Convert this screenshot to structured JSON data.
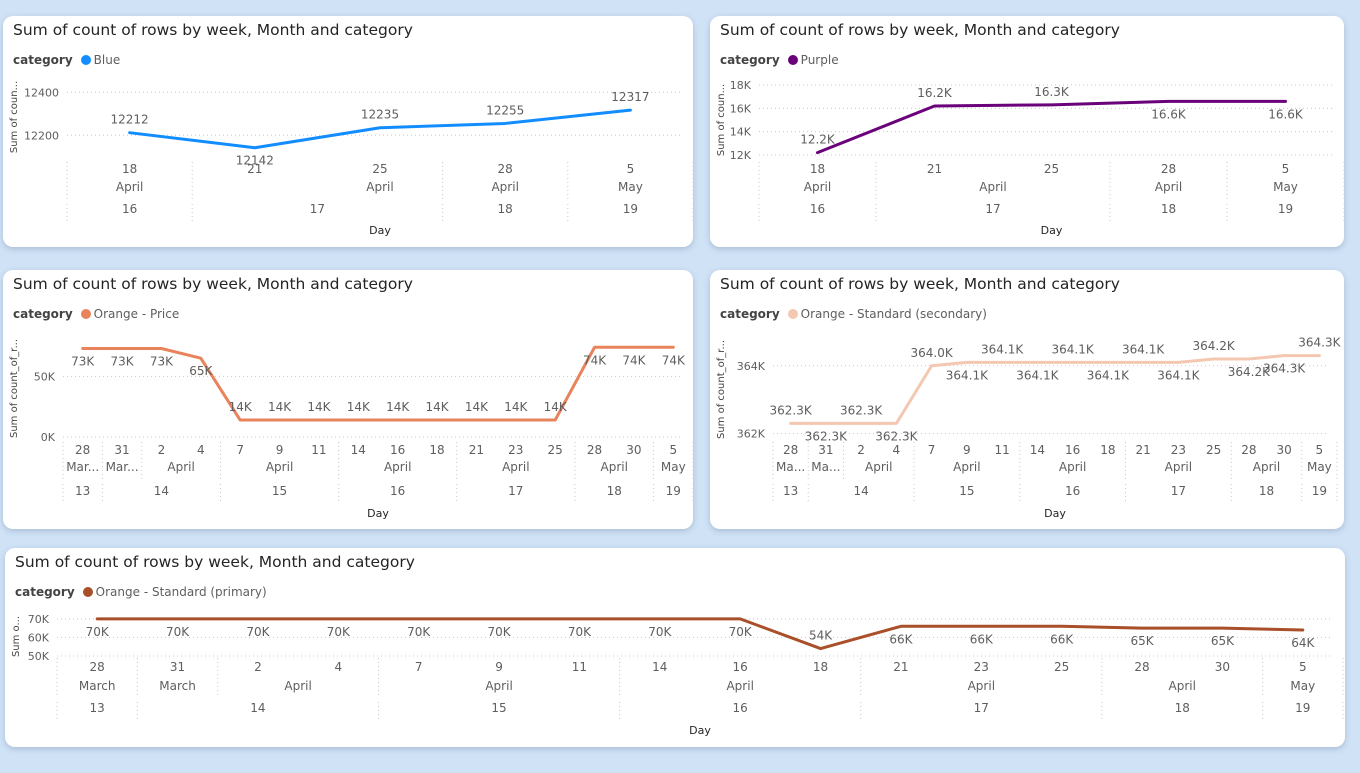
{
  "chart_data": [
    {
      "type": "line",
      "title": "Sum of count of rows by week, Month and category",
      "legend_title": "category",
      "legend_position": "top-left",
      "series": [
        {
          "name": "Blue",
          "color": "#118DFF",
          "values": [
            12212,
            12142,
            12235,
            12255,
            12317
          ]
        }
      ],
      "data_labels": [
        "12212",
        "12142",
        "12235",
        "12255",
        "12317"
      ],
      "xlabel": "Day",
      "ylabel": "Sum of coun...",
      "ylim": [
        12150,
        12420
      ],
      "yticks": [
        12200,
        12400
      ],
      "ytick_labels": [
        "12200",
        "12400"
      ],
      "days": [
        "18",
        "21",
        "25",
        "28",
        "5"
      ],
      "months": [
        {
          "label": "April",
          "start": 0,
          "end": 1
        },
        {
          "label": "April",
          "start": 1,
          "end": 4
        },
        {
          "label": "April",
          "start": 3,
          "end": 4
        },
        {
          "label": "May",
          "start": 4,
          "end": 5
        }
      ],
      "weeks": [
        {
          "label": "16",
          "start": 0,
          "end": 1
        },
        {
          "label": "17",
          "start": 1,
          "end": 3
        },
        {
          "label": "18",
          "start": 3,
          "end": 4
        },
        {
          "label": "19",
          "start": 4,
          "end": 5
        }
      ],
      "grid": true
    },
    {
      "type": "line",
      "title": "Sum of count of rows by week, Month and category",
      "legend_title": "category",
      "legend_position": "top-left",
      "series": [
        {
          "name": "Purple",
          "color": "#6B007B",
          "values": [
            12200,
            16200,
            16300,
            16600,
            16600
          ]
        }
      ],
      "data_labels": [
        "12.2K",
        "16.2K",
        "16.3K",
        "16.6K",
        "16.6K"
      ],
      "xlabel": "Day",
      "ylabel": "Sum of coun...",
      "ylim": [
        12000,
        18000
      ],
      "yticks": [
        12000,
        14000,
        16000,
        18000
      ],
      "ytick_labels": [
        "12K",
        "14K",
        "16K",
        "18K"
      ],
      "days": [
        "18",
        "21",
        "25",
        "28",
        "5"
      ],
      "months": [
        {
          "label": "April",
          "start": 0,
          "end": 1
        },
        {
          "label": "April",
          "start": 1,
          "end": 3
        },
        {
          "label": "April",
          "start": 3,
          "end": 4
        },
        {
          "label": "May",
          "start": 4,
          "end": 5
        }
      ],
      "weeks": [
        {
          "label": "16",
          "start": 0,
          "end": 1
        },
        {
          "label": "17",
          "start": 1,
          "end": 3
        },
        {
          "label": "18",
          "start": 3,
          "end": 4
        },
        {
          "label": "19",
          "start": 4,
          "end": 5
        }
      ],
      "grid": true
    },
    {
      "type": "line",
      "title": "Sum of count of rows by week, Month and category",
      "legend_title": "category",
      "legend_position": "top-left",
      "series": [
        {
          "name": "Orange - Price",
          "color": "#E8835B",
          "values": [
            73000,
            73000,
            73000,
            65000,
            14000,
            14000,
            14000,
            14000,
            14000,
            14000,
            14000,
            14000,
            14000,
            74000,
            74000,
            74000
          ]
        }
      ],
      "data_labels": [
        "73K",
        "73K",
        "73K",
        "65K",
        "14K",
        "14K",
        "14K",
        "14K",
        "14K",
        "14K",
        "14K",
        "14K",
        "14K",
        "74K",
        "74K",
        "74K"
      ],
      "xlabel": "Day",
      "ylabel": "Sum of count_of_r...",
      "ylim": [
        0,
        80000
      ],
      "yticks": [
        0,
        50000
      ],
      "ytick_labels": [
        "0K",
        "50K"
      ],
      "days": [
        "28",
        "31",
        "2",
        "4",
        "7",
        "9",
        "11",
        "14",
        "16",
        "18",
        "21",
        "23",
        "25",
        "28",
        "30",
        "5"
      ],
      "months": [
        {
          "label": "Mar...",
          "start": 0,
          "end": 1
        },
        {
          "label": "Mar...",
          "start": 1,
          "end": 2
        },
        {
          "label": "April",
          "start": 2,
          "end": 4
        },
        {
          "label": "April",
          "start": 4,
          "end": 7
        },
        {
          "label": "April",
          "start": 7,
          "end": 10
        },
        {
          "label": "April",
          "start": 10,
          "end": 13
        },
        {
          "label": "April",
          "start": 13,
          "end": 15
        },
        {
          "label": "May",
          "start": 15,
          "end": 16
        }
      ],
      "weeks": [
        {
          "label": "13",
          "start": 0,
          "end": 1
        },
        {
          "label": "14",
          "start": 1,
          "end": 4
        },
        {
          "label": "15",
          "start": 4,
          "end": 7
        },
        {
          "label": "16",
          "start": 7,
          "end": 10
        },
        {
          "label": "17",
          "start": 10,
          "end": 13
        },
        {
          "label": "18",
          "start": 13,
          "end": 15
        },
        {
          "label": "19",
          "start": 15,
          "end": 16
        }
      ],
      "grid": true
    },
    {
      "type": "line",
      "title": "Sum of count of rows by week, Month and category",
      "legend_title": "category",
      "legend_position": "top-left",
      "series": [
        {
          "name": "Orange - Standard (secondary)",
          "color": "#F4C7B0",
          "values": [
            362300,
            362300,
            362300,
            362300,
            364000,
            364100,
            364100,
            364100,
            364100,
            364100,
            364100,
            364100,
            364200,
            364200,
            364300,
            364300
          ]
        }
      ],
      "data_labels": [
        "362.3K",
        "362.3K",
        "362.3K",
        "362.3K",
        "364.0K",
        "364.1K",
        "364.1K",
        "364.1K",
        "364.1K",
        "364.1K",
        "364.1K",
        "364.1K",
        "364.2K",
        "364.2K",
        "364.3K",
        "364.3K"
      ],
      "xlabel": "Day",
      "ylabel": "Sum of count_of_r...",
      "ylim": [
        361900,
        364700
      ],
      "yticks": [
        362000,
        364000
      ],
      "ytick_labels": [
        "362K",
        "364K"
      ],
      "days": [
        "28",
        "31",
        "2",
        "4",
        "7",
        "9",
        "11",
        "14",
        "16",
        "18",
        "21",
        "23",
        "25",
        "28",
        "30",
        "5"
      ],
      "months": [
        {
          "label": "Ma...",
          "start": 0,
          "end": 1
        },
        {
          "label": "Ma...",
          "start": 1,
          "end": 2
        },
        {
          "label": "April",
          "start": 2,
          "end": 4
        },
        {
          "label": "April",
          "start": 4,
          "end": 7
        },
        {
          "label": "April",
          "start": 7,
          "end": 10
        },
        {
          "label": "April",
          "start": 10,
          "end": 13
        },
        {
          "label": "April",
          "start": 13,
          "end": 15
        },
        {
          "label": "May",
          "start": 15,
          "end": 16
        }
      ],
      "weeks": [
        {
          "label": "13",
          "start": 0,
          "end": 1
        },
        {
          "label": "14",
          "start": 1,
          "end": 4
        },
        {
          "label": "15",
          "start": 4,
          "end": 7
        },
        {
          "label": "16",
          "start": 7,
          "end": 10
        },
        {
          "label": "17",
          "start": 10,
          "end": 13
        },
        {
          "label": "18",
          "start": 13,
          "end": 15
        },
        {
          "label": "19",
          "start": 15,
          "end": 16
        }
      ],
      "grid": true
    },
    {
      "type": "line",
      "title": "Sum of count of rows by week, Month and category",
      "legend_title": "category",
      "legend_position": "top-left",
      "series": [
        {
          "name": "Orange - Standard (primary)",
          "color": "#A94F2A",
          "values": [
            70000,
            70000,
            70000,
            70000,
            70000,
            70000,
            70000,
            70000,
            70000,
            54000,
            66000,
            66000,
            66000,
            65000,
            65000,
            64000
          ]
        }
      ],
      "data_labels": [
        "70K",
        "70K",
        "70K",
        "70K",
        "70K",
        "70K",
        "70K",
        "70K",
        "70K",
        "54K",
        "66K",
        "66K",
        "66K",
        "65K",
        "65K",
        "64K"
      ],
      "xlabel": "Day",
      "ylabel": "Sum o...",
      "ylim": [
        50000,
        71000
      ],
      "yticks": [
        50000,
        60000,
        70000
      ],
      "ytick_labels": [
        "50K",
        "60K",
        "70K"
      ],
      "days": [
        "28",
        "31",
        "2",
        "4",
        "7",
        "9",
        "11",
        "14",
        "16",
        "18",
        "21",
        "23",
        "25",
        "28",
        "30",
        "5"
      ],
      "months": [
        {
          "label": "March",
          "start": 0,
          "end": 1
        },
        {
          "label": "March",
          "start": 1,
          "end": 2
        },
        {
          "label": "April",
          "start": 2,
          "end": 4
        },
        {
          "label": "April",
          "start": 4,
          "end": 7
        },
        {
          "label": "April",
          "start": 7,
          "end": 10
        },
        {
          "label": "April",
          "start": 10,
          "end": 13
        },
        {
          "label": "April",
          "start": 13,
          "end": 15
        },
        {
          "label": "May",
          "start": 15,
          "end": 16
        }
      ],
      "weeks": [
        {
          "label": "13",
          "start": 0,
          "end": 1
        },
        {
          "label": "14",
          "start": 1,
          "end": 4
        },
        {
          "label": "15",
          "start": 4,
          "end": 7
        },
        {
          "label": "16",
          "start": 7,
          "end": 10
        },
        {
          "label": "17",
          "start": 10,
          "end": 13
        },
        {
          "label": "18",
          "start": 13,
          "end": 15
        },
        {
          "label": "19",
          "start": 15,
          "end": 16
        }
      ],
      "grid": true
    }
  ]
}
